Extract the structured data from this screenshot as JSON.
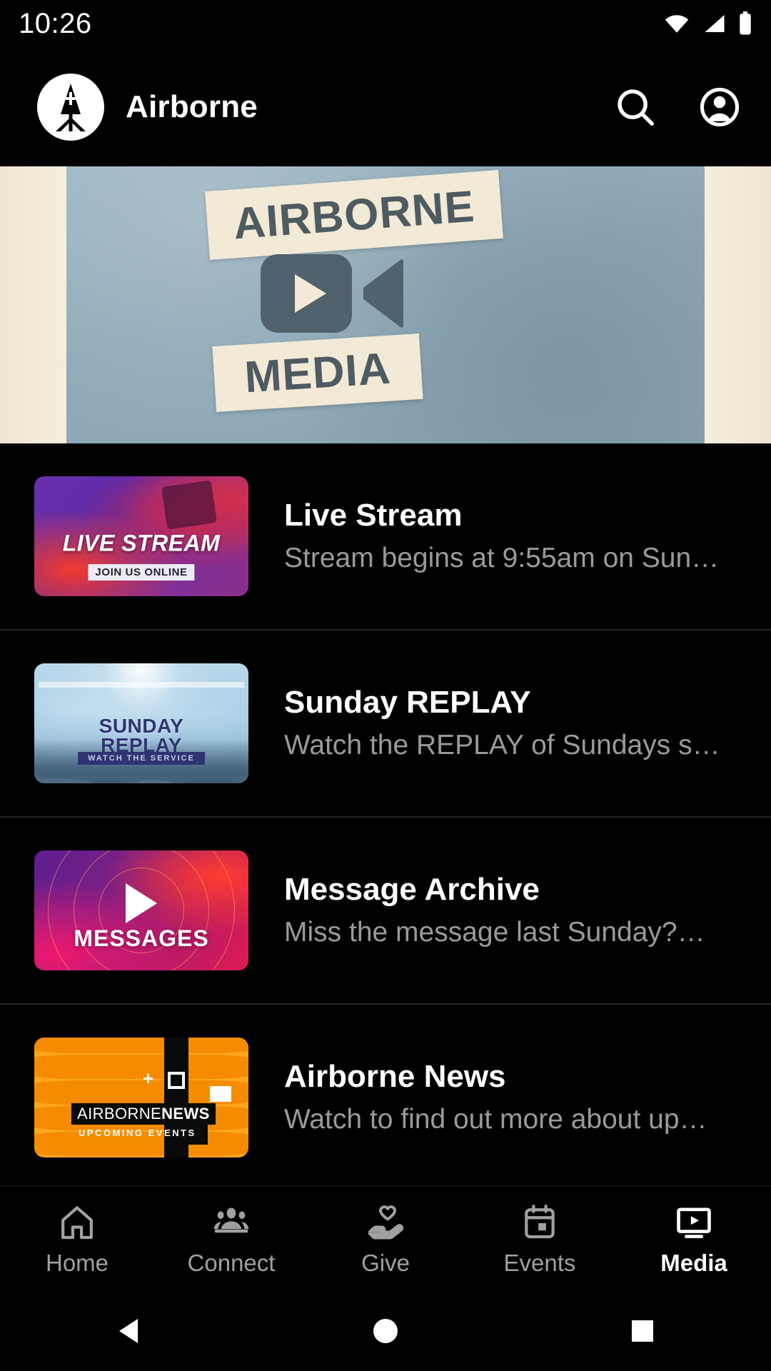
{
  "status_bar": {
    "time": "10:26",
    "icons": [
      "wifi-icon",
      "cellular-signal-icon",
      "battery-icon"
    ]
  },
  "app_bar": {
    "logo_icon": "airborne-logo-icon",
    "title": "Airborne",
    "search_icon": "search-icon",
    "account_icon": "account-circle-icon"
  },
  "hero": {
    "line1": "AIRBORNE",
    "line2": "MEDIA",
    "icon": "video-camera-play-icon",
    "colors": {
      "paper": "#8fa9b7",
      "tape": "#f2e9d6",
      "ink": "#4e5b61"
    }
  },
  "media_items": [
    {
      "title": "Live Stream",
      "subtitle": "Stream begins at 9:55am on Sun…",
      "thumb": {
        "style": "live",
        "label": "LIVE STREAM",
        "badge": "JOIN US ONLINE"
      }
    },
    {
      "title": "Sunday REPLAY",
      "subtitle": "Watch the REPLAY of Sundays s…",
      "thumb": {
        "style": "replay",
        "label_line1": "SUNDAY",
        "label_line2": "REPLAY",
        "badge": "WATCH THE SERVICE"
      }
    },
    {
      "title": "Message Archive",
      "subtitle": "Miss the message last Sunday?…",
      "thumb": {
        "style": "messages",
        "label": "MESSAGES",
        "play_icon": "play-triangle-icon"
      }
    },
    {
      "title": "Airborne News",
      "subtitle": "Watch to find out more about up…",
      "thumb": {
        "style": "news",
        "label_part1": "AIRBORNE",
        "label_part2": "NEWS",
        "badge": "UPCOMING EVENTS"
      }
    }
  ],
  "bottom_nav": {
    "active": "Media",
    "items": [
      {
        "label": "Home",
        "icon": "home-icon"
      },
      {
        "label": "Connect",
        "icon": "people-group-icon"
      },
      {
        "label": "Give",
        "icon": "hand-heart-icon"
      },
      {
        "label": "Events",
        "icon": "calendar-icon"
      },
      {
        "label": "Media",
        "icon": "tv-play-icon"
      }
    ]
  },
  "system_nav": {
    "back": "back-triangle-icon",
    "home": "home-circle-icon",
    "recents": "recents-square-icon"
  }
}
